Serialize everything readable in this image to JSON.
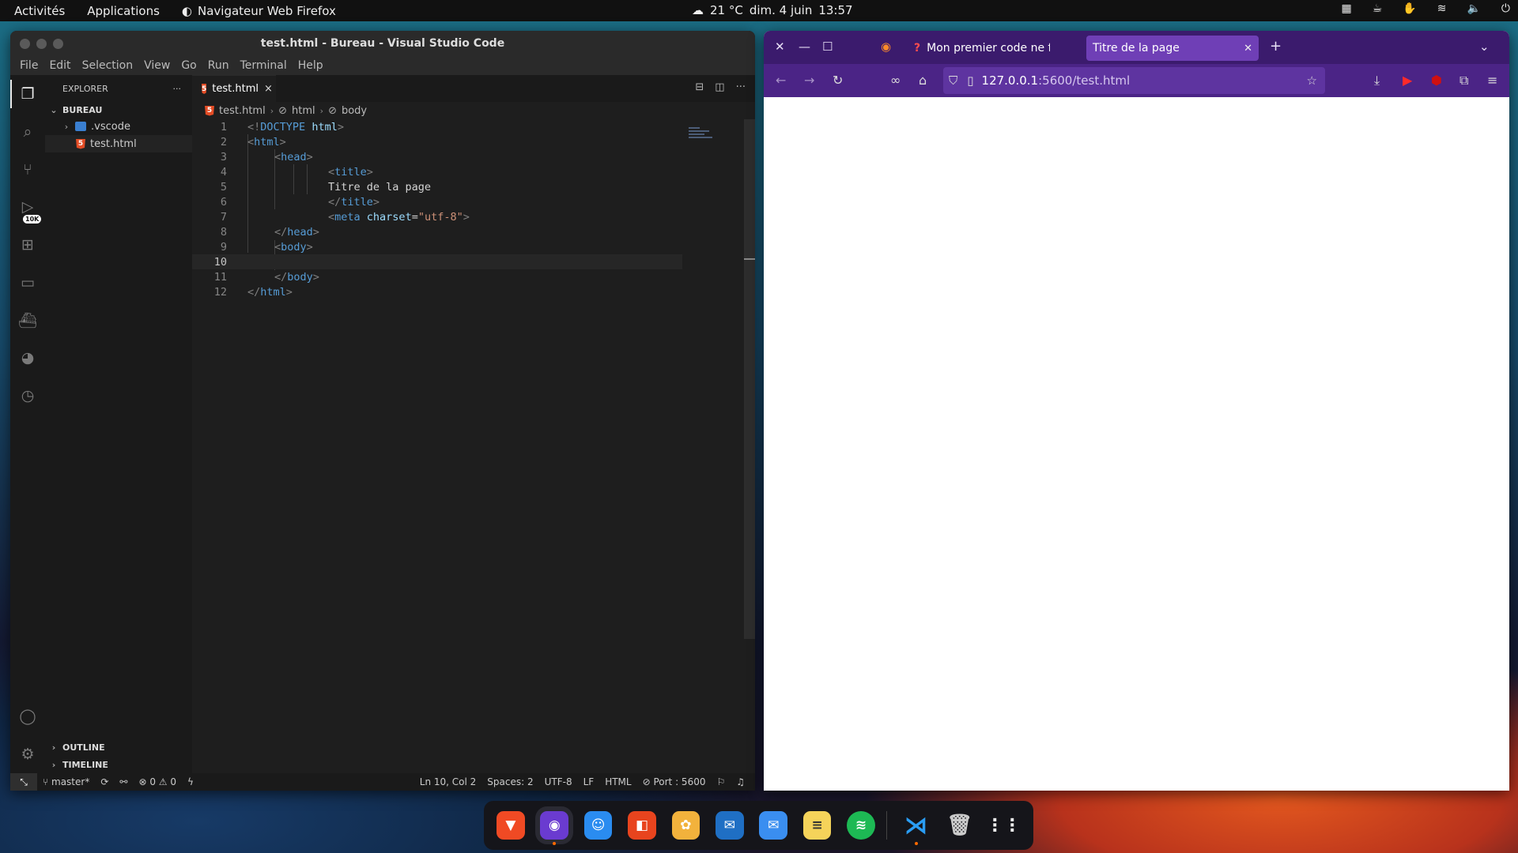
{
  "topbar": {
    "activities": "Activités",
    "applications": "Applications",
    "active_app": "Navigateur Web Firefox",
    "weather": "21 °C",
    "date": "dim. 4 juin",
    "time": "13:57",
    "tray_icons": [
      "workspace-icon",
      "cup-icon",
      "hand-icon",
      "wifi-icon",
      "volume-icon",
      "power-icon"
    ]
  },
  "vscode": {
    "title": "test.html - Bureau - Visual Studio Code",
    "menu": [
      "File",
      "Edit",
      "Selection",
      "View",
      "Go",
      "Run",
      "Terminal",
      "Help"
    ],
    "activity_badge": "10K",
    "explorer": {
      "header": "EXPLORER",
      "more": "···",
      "folder": "BUREAU",
      "items": [
        {
          "name": ".vscode",
          "type": "folder"
        },
        {
          "name": "test.html",
          "type": "file"
        }
      ],
      "outline": "OUTLINE",
      "timeline": "TIMELINE"
    },
    "tab": {
      "label": "test.html",
      "close": "×"
    },
    "breadcrumb": [
      "test.html",
      "html",
      "body"
    ],
    "code_lines": [
      "1",
      "2",
      "3",
      "4",
      "5",
      "6",
      "7",
      "8",
      "9",
      "10",
      "11",
      "12"
    ],
    "code_text": {
      "doctype": "DOCTYPE",
      "html": "html",
      "head": "head",
      "title": "title",
      "title_text": "Titre de la page",
      "meta": "meta",
      "charset_attr": "charset",
      "charset_val": "\"utf-8\"",
      "body": "body"
    },
    "status": {
      "branch": "master*",
      "errors": "0",
      "warnings": "0",
      "position": "Ln 10, Col 2",
      "spaces": "Spaces: 2",
      "encoding": "UTF-8",
      "eol": "LF",
      "language": "HTML",
      "port": "Port : 5600"
    }
  },
  "firefox": {
    "tabs": [
      {
        "label": "Mon premier code ne fon",
        "active": false
      },
      {
        "label": "Titre de la page",
        "active": true
      }
    ],
    "new_tab": "+",
    "url_host": "127.0.0.1",
    "url_path": ":5600/test.html"
  },
  "dock": {
    "apps": [
      "brave-icon",
      "firefox-icon",
      "finder-icon",
      "office-icon",
      "photos-icon",
      "thunderbird-icon",
      "mail-icon",
      "notes-icon",
      "spotify-icon",
      "vscode-icon",
      "trash-icon",
      "app-grid-icon"
    ]
  },
  "colors": {
    "vscode_bg": "#1e1e1e",
    "firefox_header": "#3b1b6d",
    "firefox_active_tab": "#6f3fb6",
    "html_tag": "#569cd6",
    "attr_value": "#ce9178"
  }
}
